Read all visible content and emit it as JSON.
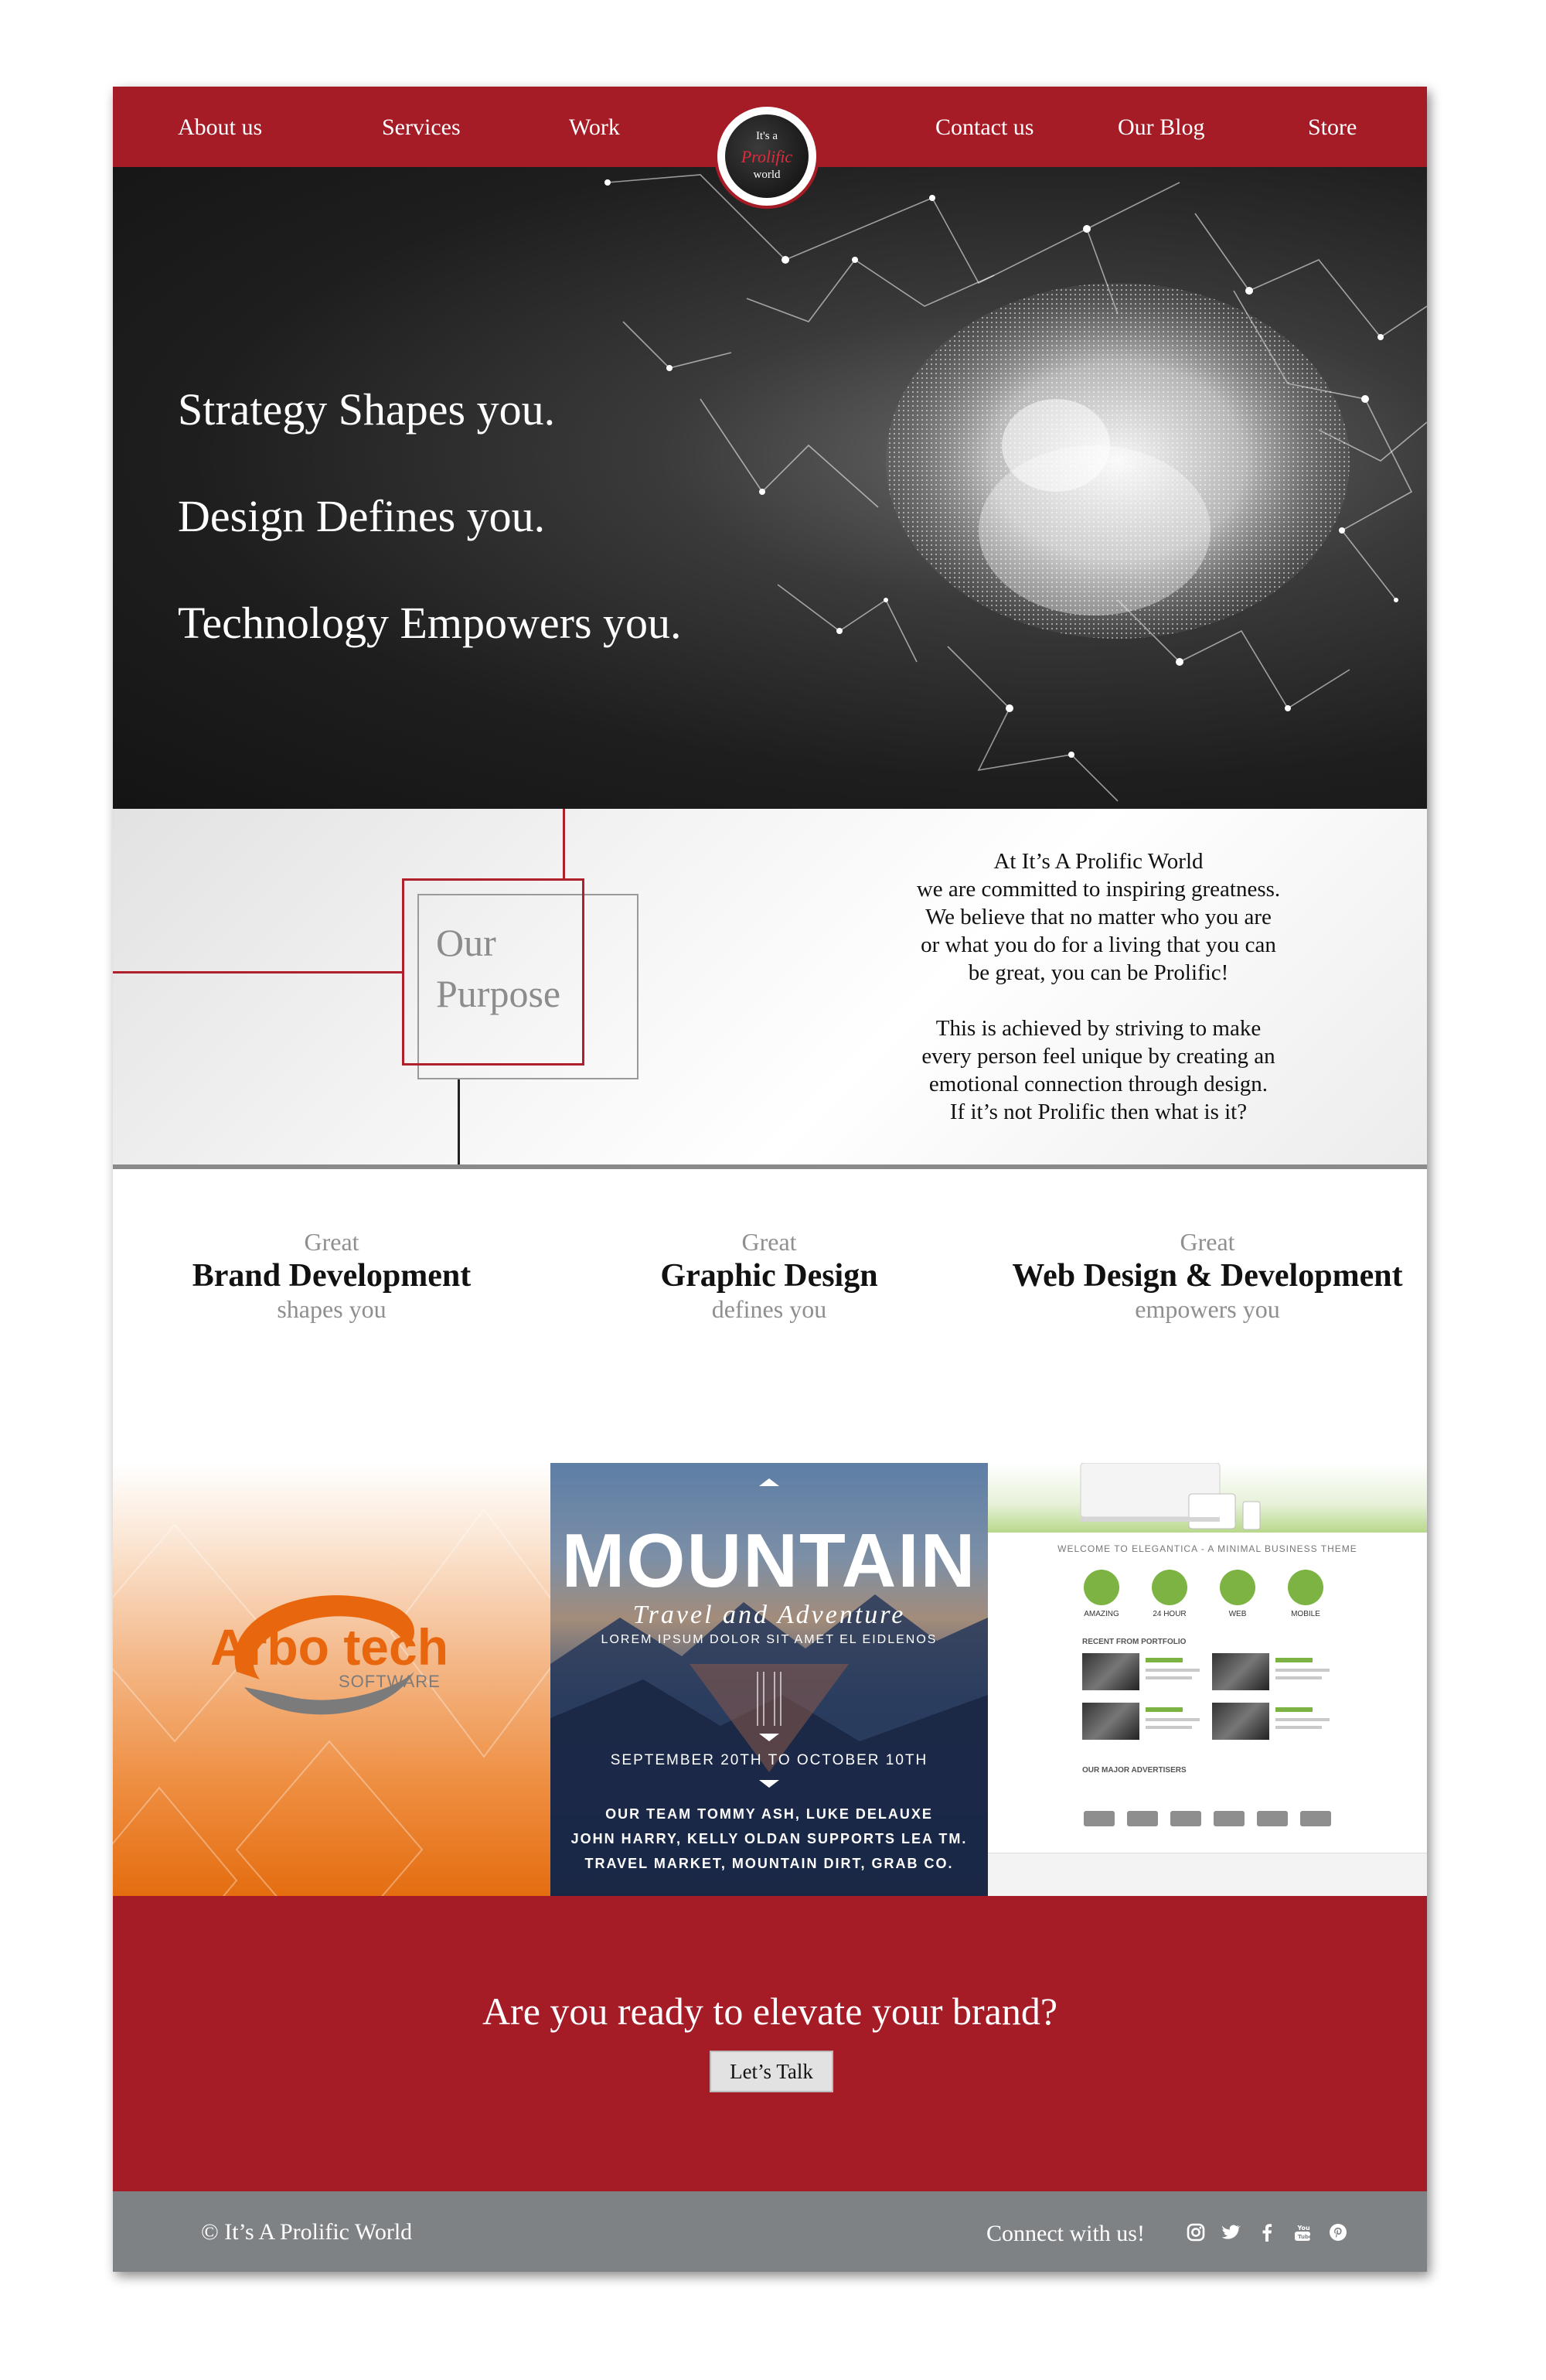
{
  "nav": {
    "about": "About us",
    "services": "Services",
    "work": "Work",
    "contact": "Contact us",
    "blog": "Our Blog",
    "store": "Store"
  },
  "logo": {
    "line1": "It's a",
    "line2": "Prolific",
    "line3": "world"
  },
  "hero": {
    "line1": "Strategy Shapes you.",
    "line2": "Design Defines you.",
    "line3": "Technology Empowers you."
  },
  "purpose": {
    "title_line1": "Our",
    "title_line2": "Purpose",
    "para1": [
      "At It’s A Prolific World",
      "we are committed to inspiring greatness.",
      "We believe that no matter who you are",
      "or what you do for a living that you can",
      "be great, you can be Prolific!"
    ],
    "para2": [
      "This is achieved by striving to make",
      "every person feel unique by creating an",
      "emotional connection through design.",
      "If it’s not Prolific then what is it?"
    ]
  },
  "services": [
    {
      "great": "Great",
      "title": "Brand Development",
      "sub": "shapes you"
    },
    {
      "great": "Great",
      "title": "Graphic Design",
      "sub": "defines you"
    },
    {
      "great": "Great",
      "title": "Web Design & Development",
      "sub": "empowers you"
    }
  ],
  "arbo": {
    "name": "Arbo tech",
    "software": "SOFTWARE"
  },
  "mountain": {
    "title": "MOUNTAIN",
    "subtitle": "Travel and Adventure",
    "lorem": "LOREM IPSUM DOLOR SIT AMET EL EIDLENOS",
    "dates": "SEPTEMBER 20TH TO OCTOBER 10TH",
    "credit1": "OUR TEAM  TOMMY ASH, LUKE DELAUXE",
    "credit2": "JOHN HARRY, KELLY OLDAN  SUPPORTS  LEA TM.",
    "credit3": "TRAVEL MARKET, MOUNTAIN DIRT, GRAB CO."
  },
  "web": {
    "welcome": "WELCOME TO ELEGANTICA - A MINIMAL BUSINESS THEME",
    "features": [
      "AMAZING",
      "24 HOUR",
      "WEB",
      "MOBILE"
    ],
    "recent": "RECENT FROM PORTFOLIO",
    "advertisers": "OUR MAJOR ADVERTISERS"
  },
  "cta": {
    "text": "Are you ready to elevate your brand?",
    "button": "Let’s Talk"
  },
  "footer": {
    "copyright": "© It’s A Prolific World",
    "connect": "Connect with us!",
    "social": [
      "instagram-icon",
      "twitter-icon",
      "facebook-icon",
      "youtube-icon",
      "pinterest-icon"
    ]
  },
  "colors": {
    "brand_red": "#a51c27",
    "footer_grey": "#7f8285",
    "accent_green": "#7cb342",
    "arbo_orange": "#e8660d"
  }
}
